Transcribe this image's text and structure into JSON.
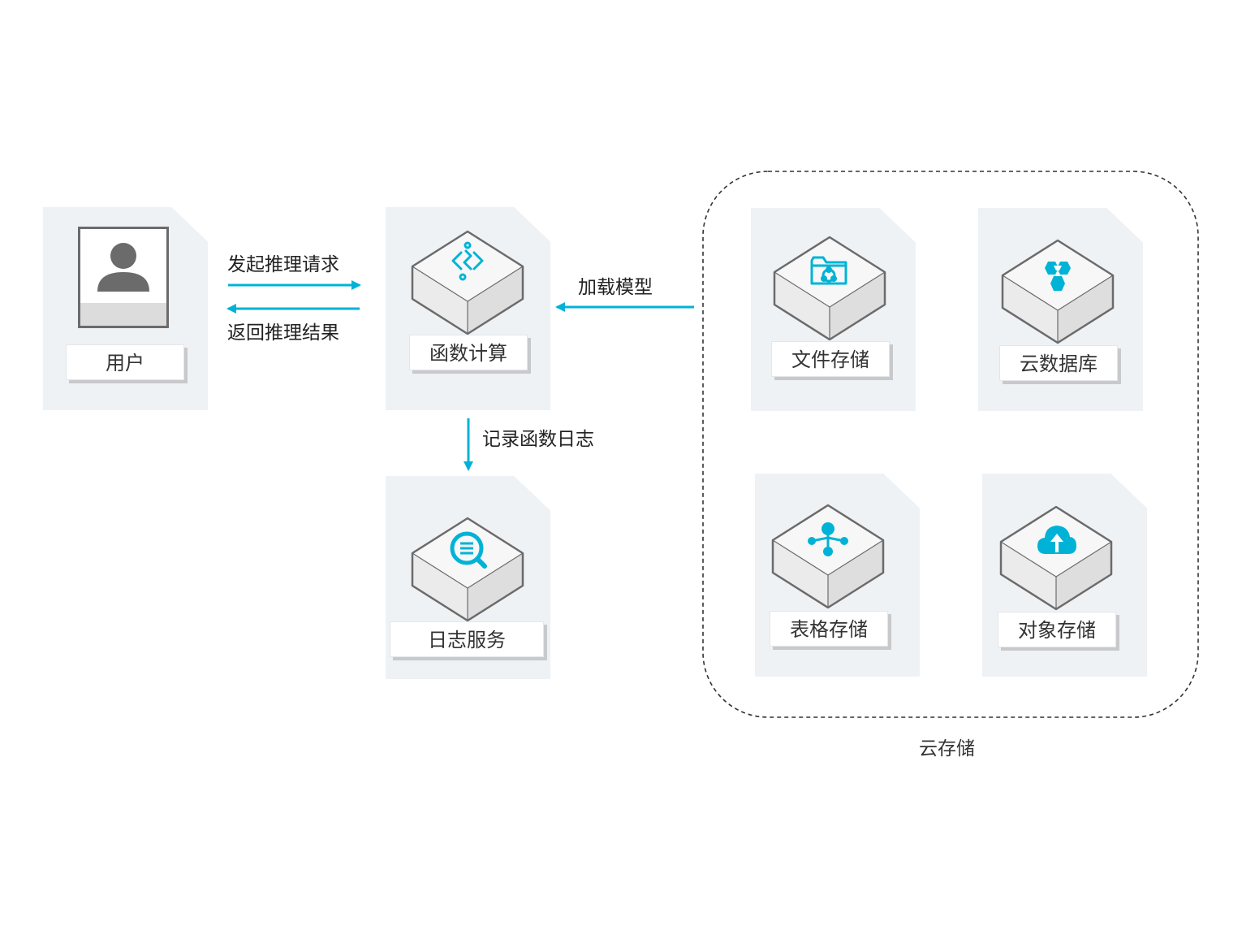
{
  "nodes": {
    "user": {
      "label": "用户",
      "icon": "user-avatar-icon"
    },
    "function_compute": {
      "label": "函数计算",
      "icon": "function-code-icon"
    },
    "log_service": {
      "label": "日志服务",
      "icon": "log-search-icon"
    },
    "file_storage": {
      "label": "文件存储",
      "icon": "folder-share-icon"
    },
    "cloud_database": {
      "label": "云数据库",
      "icon": "hexagon-cluster-icon"
    },
    "table_storage": {
      "label": "表格存储",
      "icon": "tree-nodes-icon"
    },
    "object_storage": {
      "label": "对象存储",
      "icon": "cloud-upload-icon"
    }
  },
  "edges": {
    "request": "发起推理请求",
    "response": "返回推理结果",
    "load_model": "加载模型",
    "log": "记录函数日志"
  },
  "groups": {
    "cloud_storage": {
      "label": "云存储"
    }
  },
  "colors": {
    "accent": "#00b3d6",
    "card_bg": "#eff2f5",
    "cube_outline": "#6b6b6b",
    "cube_top": "#f7f7f7",
    "cube_side_left": "#ebebeb",
    "cube_side_right": "#dcdcdc"
  }
}
